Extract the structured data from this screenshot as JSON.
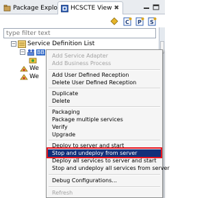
{
  "tabs": [
    {
      "label": "Package Explorer",
      "icon": "package-icon"
    },
    {
      "label": "HCSCTE View",
      "icon": "hcscte-view-icon",
      "close": "✖"
    }
  ],
  "filter": {
    "placeholder": "type filter text"
  },
  "tree": {
    "root_label": "Service Definition List",
    "selected_label": "BB",
    "child_labels": [
      "We",
      "We"
    ]
  },
  "context_menu": {
    "items": [
      {
        "label": "Add Service Adapter",
        "enabled": false
      },
      {
        "label": "Add Business Process",
        "enabled": false
      },
      {
        "label": "Add User Defined Reception",
        "enabled": true
      },
      {
        "label": "Delete User Defined Reception",
        "enabled": true
      },
      {
        "label": "Duplicate",
        "enabled": true
      },
      {
        "label": "Delete",
        "enabled": true
      },
      {
        "label": "Packaging",
        "enabled": true
      },
      {
        "label": "Package multiple services",
        "enabled": true
      },
      {
        "label": "Verify",
        "enabled": true
      },
      {
        "label": "Upgrade",
        "enabled": true
      },
      {
        "label": "Deploy to server and start",
        "enabled": true
      },
      {
        "label": "Stop and undeploy from server",
        "enabled": true,
        "highlighted": true
      },
      {
        "label": "Deploy all services to server and start",
        "enabled": true
      },
      {
        "label": "Stop and undeploy all services from server",
        "enabled": true
      },
      {
        "label": "Debug Configurations...",
        "enabled": true
      },
      {
        "label": "Refresh",
        "enabled": false
      }
    ]
  },
  "colors": {
    "menu_highlight": "#12307a",
    "annotation_border": "#e8141e",
    "tree_selection": "#3169c6"
  }
}
